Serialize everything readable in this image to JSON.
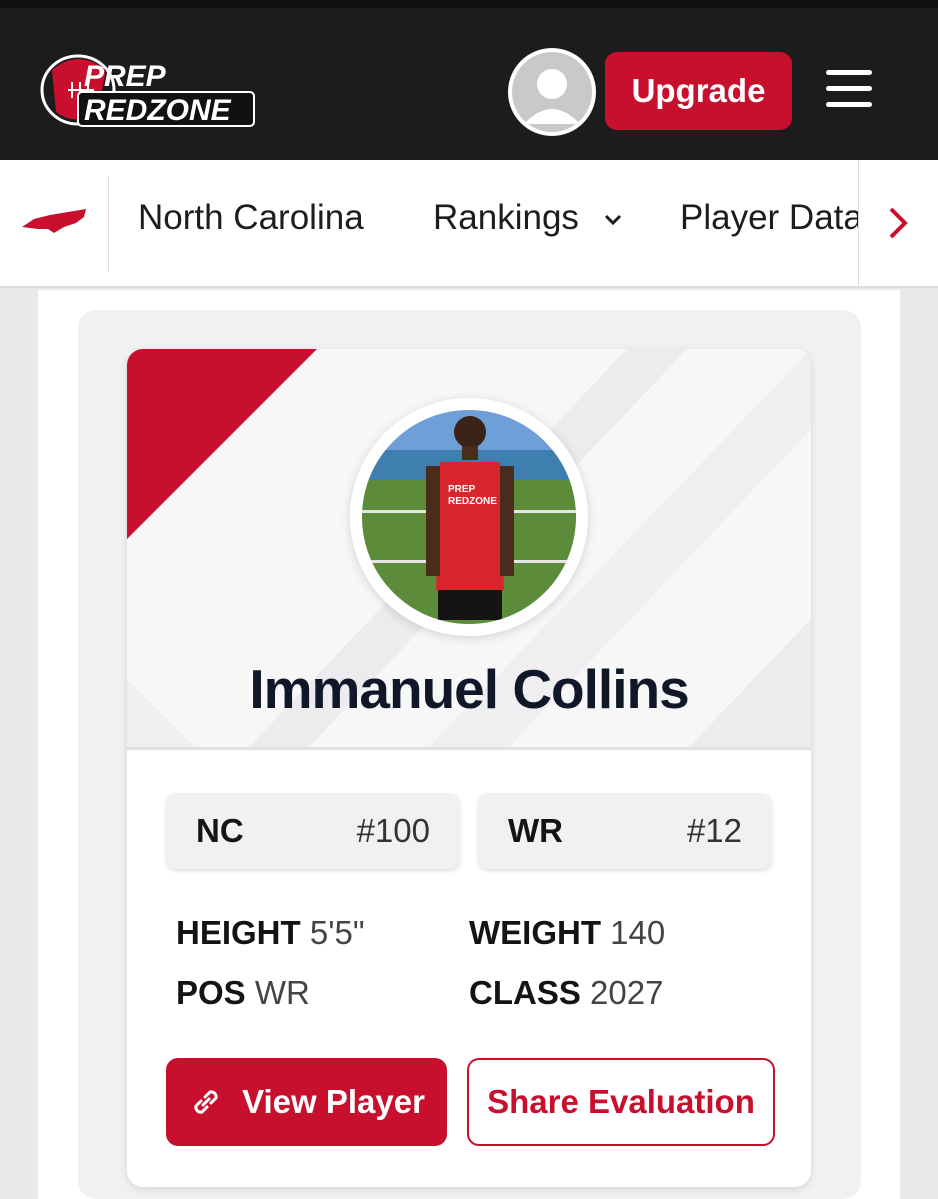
{
  "header": {
    "logo_text": [
      "PREP",
      "REDZONE"
    ],
    "upgrade_label": "Upgrade"
  },
  "subnav": {
    "state": "North Carolina",
    "rankings": "Rankings",
    "player_data": "Player Data"
  },
  "player": {
    "name": "Immanuel Collins",
    "ranks": [
      {
        "label": "NC",
        "value": "#100"
      },
      {
        "label": "WR",
        "value": "#12"
      }
    ],
    "attributes": {
      "height_label": "HEIGHT",
      "height": "5'5\"",
      "weight_label": "WEIGHT",
      "weight": "140",
      "pos_label": "POS",
      "pos": "WR",
      "class_label": "CLASS",
      "class": "2027"
    }
  },
  "actions": {
    "view_player": "View Player",
    "share_evaluation": "Share Evaluation"
  },
  "icons": [
    "state-map-icon",
    "chevron-down-icon",
    "chevron-right-icon",
    "menu-icon",
    "link-icon",
    "avatar-placeholder-icon"
  ],
  "colors": {
    "brand_red": "#c8102e",
    "topbar": "#1c1c1c",
    "name_text": "#0f1729"
  }
}
